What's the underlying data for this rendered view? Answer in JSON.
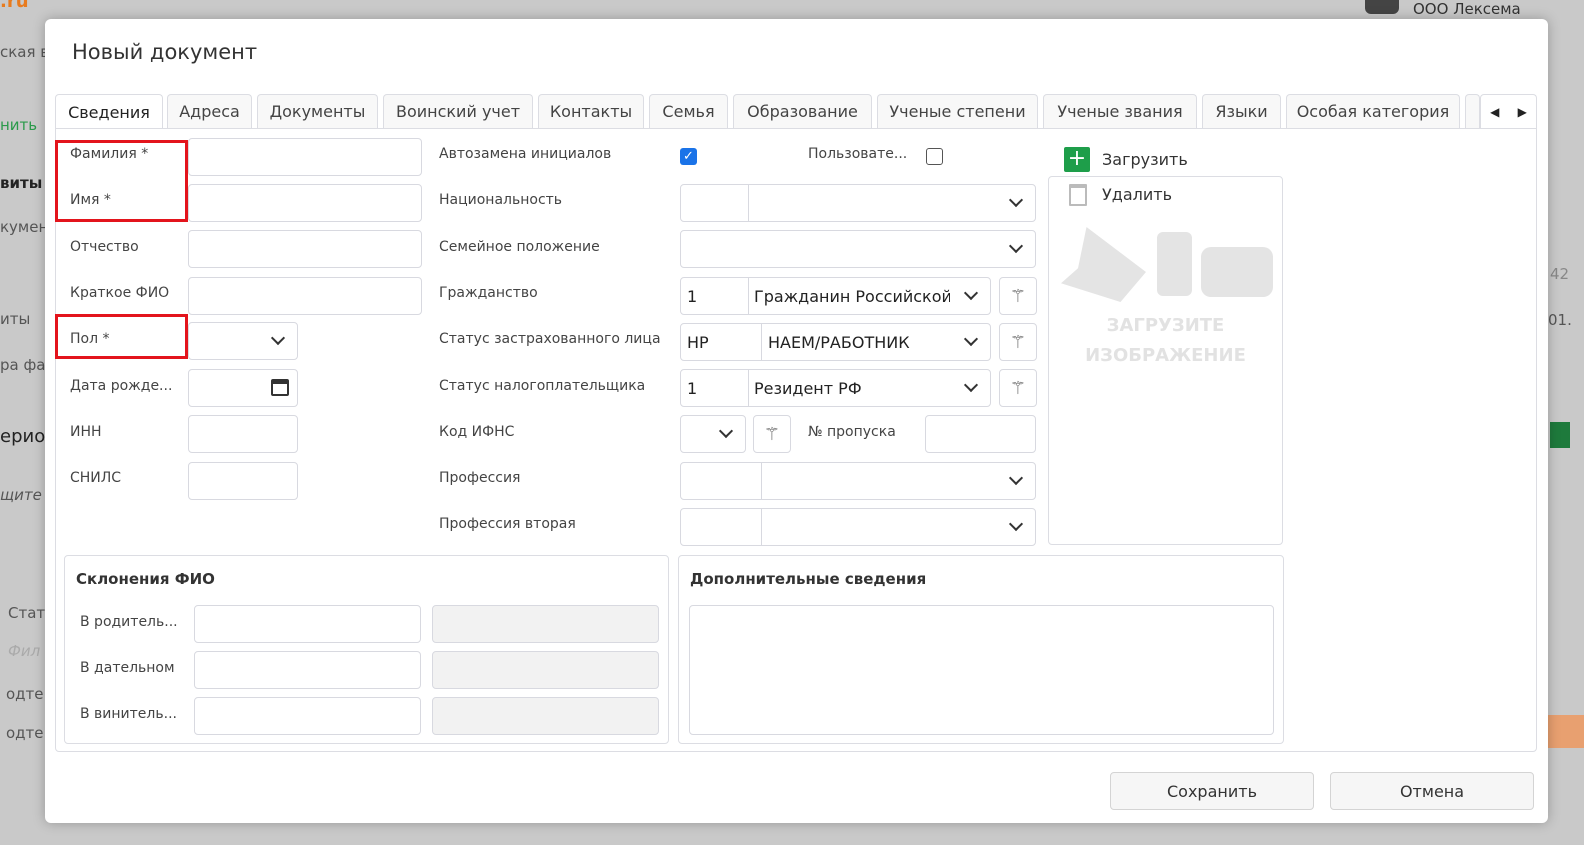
{
  "background": {
    "company": "ООО Лексема",
    "fragments": [
      "ская в",
      "нить",
      "виты",
      "кумен",
      "иты",
      "ра фа",
      "ериод",
      "щите",
      "Стат",
      "Фил",
      "одте",
      "одте",
      "42",
      "01."
    ]
  },
  "modal": {
    "title": "Новый документ",
    "tabs": [
      "Сведения",
      "Адреса",
      "Документы",
      "Воинский учет",
      "Контакты",
      "Семья",
      "Образование",
      "Ученые степени",
      "Ученые звания",
      "Языки",
      "Особая категория"
    ],
    "left": {
      "surname": "Фамилия *",
      "name": "Имя *",
      "patronymic": "Отчество",
      "short_name": "Краткое ФИО",
      "gender": "Пол *",
      "birth_date": "Дата рожде...",
      "inn": "ИНН",
      "snils": "СНИЛС"
    },
    "middle": {
      "auto_initials": "Автозамена инициалов",
      "auto_initials_checked": true,
      "user_label": "Пользовате...",
      "user_checked": false,
      "nationality": "Национальность",
      "marital": "Семейное положение",
      "citizenship": "Гражданство",
      "citizenship_code": "1",
      "citizenship_value": "Гражданин Российской",
      "insured_status": "Статус застрахованного лица",
      "insured_code": "НР",
      "insured_value": "НАЕМ/РАБОТНИК",
      "tax_status": "Статус налогоплательщика",
      "tax_code": "1",
      "tax_value": "Резидент РФ",
      "ifns": "Код ИФНС",
      "pass_no": "№ пропуска",
      "profession": "Профессия",
      "profession2": "Профессия вторая"
    },
    "photo": {
      "upload": "Загрузить",
      "delete": "Удалить",
      "placeholder1": "ЗАГРУЗИТЕ",
      "placeholder2": "ИЗОБРАЖЕНИЕ"
    },
    "declension": {
      "title": "Склонения ФИО",
      "genitive": "В родитель...",
      "dative": "В дательном",
      "accusative": "В винитель..."
    },
    "extra": {
      "title": "Дополнительные сведения"
    },
    "save": "Сохранить",
    "cancel": "Отмена"
  },
  "colors": {
    "required_highlight": "#e3141c",
    "upload_green": "#1e9e4a",
    "checkbox_blue": "#1a73e8"
  }
}
